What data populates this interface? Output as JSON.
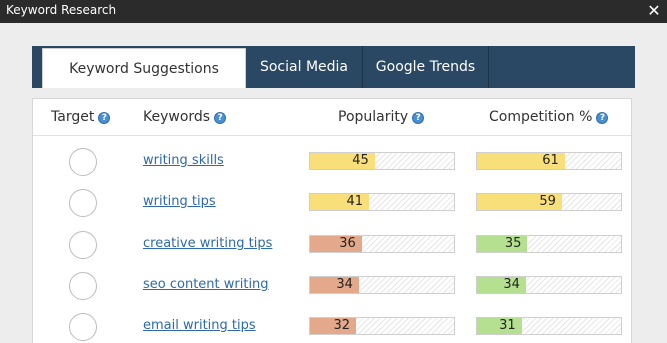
{
  "window": {
    "title": "Keyword Research",
    "close_glyph": "✕"
  },
  "tabs": [
    {
      "label": "Keyword Suggestions",
      "active": true
    },
    {
      "label": "Social Media",
      "active": false
    },
    {
      "label": "Google Trends",
      "active": false
    }
  ],
  "columns": {
    "target": "Target",
    "keywords": "Keywords",
    "popularity": "Popularity",
    "competition": "Competition %",
    "help_glyph": "?"
  },
  "colors": {
    "yellow": "#f9df7a",
    "salmon": "#e3a98a",
    "green": "#b5e08f",
    "tabbar": "#2a4763",
    "link": "#2d6aa7"
  },
  "rows": [
    {
      "keyword": "writing skills",
      "popularity": 45,
      "competition": 61,
      "pop_color": "#f9df7a",
      "comp_color": "#f9df7a"
    },
    {
      "keyword": "writing tips",
      "popularity": 41,
      "competition": 59,
      "pop_color": "#f9df7a",
      "comp_color": "#f9df7a"
    },
    {
      "keyword": "creative writing tips",
      "popularity": 36,
      "competition": 35,
      "pop_color": "#e3a98a",
      "comp_color": "#b5e08f"
    },
    {
      "keyword": "seo content writing",
      "popularity": 34,
      "competition": 34,
      "pop_color": "#e3a98a",
      "comp_color": "#b5e08f"
    },
    {
      "keyword": "email writing tips",
      "popularity": 32,
      "competition": 31,
      "pop_color": "#e3a98a",
      "comp_color": "#b5e08f"
    }
  ]
}
